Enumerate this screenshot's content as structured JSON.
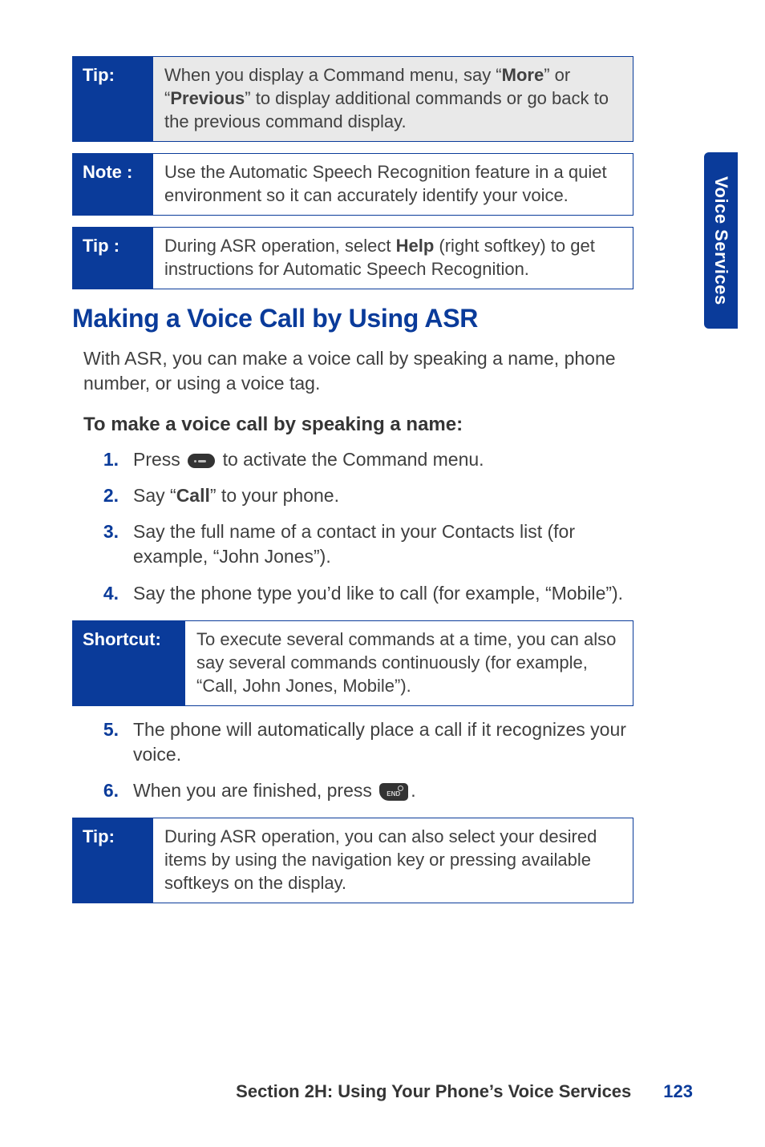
{
  "side_tab": "Voice Services",
  "callouts": {
    "tip1": {
      "label": "Tip:",
      "segments": [
        "When you display a Command menu, say “",
        "More",
        "” or “",
        "Previous",
        "” to display additional commands or go back to the previous command display."
      ]
    },
    "note": {
      "label": "Note :",
      "text": "Use the Automatic Speech Recognition feature in a quiet environment so it can accurately identify your voice."
    },
    "tip2": {
      "label": "Tip :",
      "segments": [
        "During ASR operation, select ",
        "Help",
        " (right softkey) to get instructions for Automatic Speech Recognition."
      ]
    },
    "shortcut": {
      "label": "Shortcut:",
      "text": "To execute several commands at a time, you can also say several commands continuously (for example, “Call, John Jones, Mobile”)."
    },
    "tip3": {
      "label": "Tip:",
      "text": "During ASR operation, you can also select your desired items by using the navigation key or pressing available softkeys on the display."
    }
  },
  "heading": "Making a Voice Call by Using ASR",
  "lede": "With ASR, you can make a voice call by speaking a name, phone number, or using a voice tag.",
  "subhead": "To make a voice call by speaking a name:",
  "steps_a": {
    "s1": {
      "num": "1.",
      "pre": "Press ",
      "post": " to activate the Command menu."
    },
    "s2": {
      "num": "2.",
      "pre": "Say “",
      "bold": "Call",
      "post": "” to your phone."
    },
    "s3": {
      "num": "3.",
      "text": "Say the full name of a contact in your Contacts list (for example, “John Jones”)."
    },
    "s4": {
      "num": "4.",
      "text": "Say the phone type you’d like to call (for example, “Mobile”)."
    }
  },
  "steps_b": {
    "s5": {
      "num": "5.",
      "text": "The phone will automatically place a call if it recognizes your voice."
    },
    "s6": {
      "num": "6.",
      "pre": "When you are finished, press ",
      "post": "."
    }
  },
  "footer": {
    "title": "Section 2H: Using Your Phone’s Voice Services",
    "page": "123"
  }
}
